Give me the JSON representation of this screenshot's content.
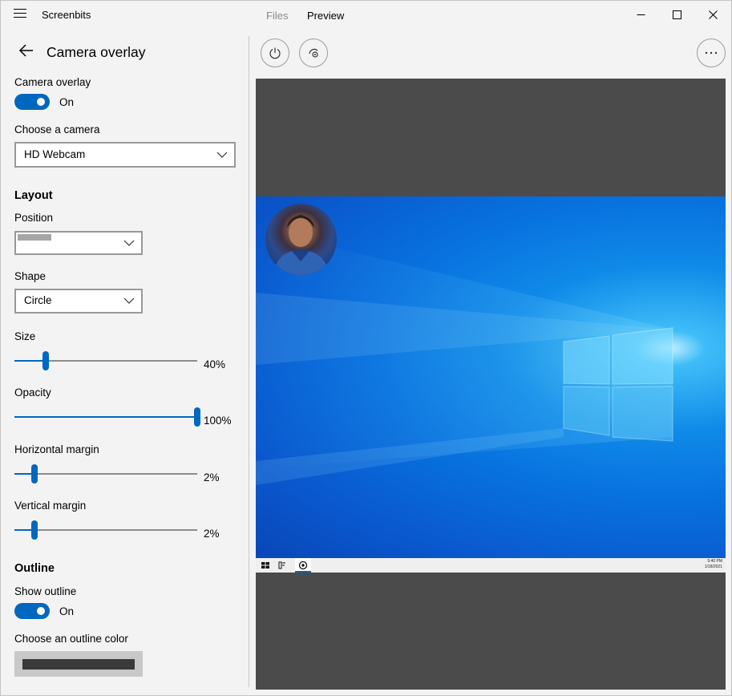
{
  "titlebar": {
    "app_title": "Screenbits",
    "tabs": [
      "Files",
      "Preview"
    ],
    "active_tab": "Preview"
  },
  "settings": {
    "title": "Camera overlay",
    "camera_overlay": {
      "label": "Camera overlay",
      "state": "On"
    },
    "camera": {
      "label": "Choose a camera",
      "value": "HD Webcam"
    },
    "layout": {
      "heading": "Layout",
      "position_label": "Position",
      "shape_label": "Shape",
      "shape_value": "Circle"
    },
    "sliders": [
      {
        "label": "Size",
        "value_text": "40%",
        "value": 0.17
      },
      {
        "label": "Opacity",
        "value_text": "100%",
        "value": 1.0
      },
      {
        "label": "Horizontal margin",
        "value_text": "2%",
        "value": 0.11
      },
      {
        "label": "Vertical margin",
        "value_text": "2%",
        "value": 0.11
      }
    ],
    "outline": {
      "heading": "Outline",
      "show_label": "Show outline",
      "show_state": "On",
      "color_label": "Choose an outline color",
      "color": "#3a3a3a"
    }
  },
  "preview": {
    "clock_time": "5:40 PM",
    "clock_date": "1/18/2021"
  },
  "colors": {
    "accent": "#0067c0",
    "preview_bg": "#4b4b4b",
    "window_bg": "#f3f3f3"
  },
  "icons": [
    "hamburger-icon",
    "back-arrow-icon",
    "chevron-down-icon",
    "power-icon",
    "camera-swap-icon",
    "more-icon",
    "minimize-icon",
    "maximize-icon",
    "close-icon"
  ]
}
